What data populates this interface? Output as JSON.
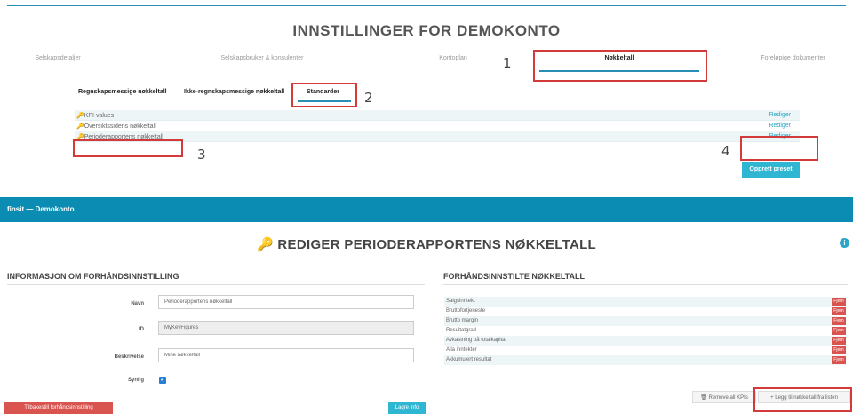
{
  "top": {
    "title": "INNSTILLINGER FOR DEMOKONTO",
    "tabs": [
      "Selskapsdetaljer",
      "Selskapsbruker & konsulenter",
      "Kontoplan",
      "Nøkkeltall",
      "Foreløpige dokumenter"
    ],
    "active_tab": "Nøkkeltall",
    "subtabs": [
      "Regnskapsmessige nøkkeltall",
      "Ikke-regnskapsmessige nøkkeltall",
      "Standarder"
    ],
    "active_subtab": "Standarder",
    "presets": [
      {
        "name": "KPI values",
        "action": "Rediger"
      },
      {
        "name": "Oversiktssidens nøkkeltall",
        "action": "Rediger"
      },
      {
        "name": "Perioderapportens nøkkeltall",
        "action": "Rediger"
      }
    ],
    "create_button": "Opprett preset",
    "callouts": [
      "1",
      "2",
      "3",
      "4"
    ]
  },
  "appbar": {
    "title": "finsit — Demokonto"
  },
  "editor": {
    "title": "REDIGER PERIODERAPPORTENS NØKKELTALL",
    "key_icon": "key-icon",
    "info_icon": "i",
    "left": {
      "section_title": "INFORMASJON OM FORHÅNDSINNSTILLING",
      "name_label": "Navn",
      "name_value": "Perioderapportens nøkkeltall",
      "id_label": "ID",
      "id_value": "MyKeyFigures",
      "desc_label": "Beskrivelse",
      "desc_value": "Mine nøkkeltall",
      "visible_label": "Synlig",
      "checkbox": "✔",
      "reset_button": "Tilbakestill forhåndsinnstilling",
      "save_button": "Lagre info"
    },
    "right": {
      "section_title": "FORHÅNDSINNSTILTE NØKKELTALL",
      "kpis": [
        "Salgsinntekt",
        "Bruttofortjeneste",
        "Brutto margin",
        "Resultatgrad",
        "Avkastning på totalkapital",
        "Alla inntekter",
        "Akkumulert resultat"
      ],
      "remove_label": "Fjern",
      "remove_all_button": "Remove all KPIs",
      "add_button": "+ Legg til nøkkeltall fra listen"
    }
  },
  "colors": {
    "accent": "#0b8db3",
    "button_blue": "#2fb6d3",
    "danger": "#d9534f",
    "annotation": "#d33a3a"
  }
}
